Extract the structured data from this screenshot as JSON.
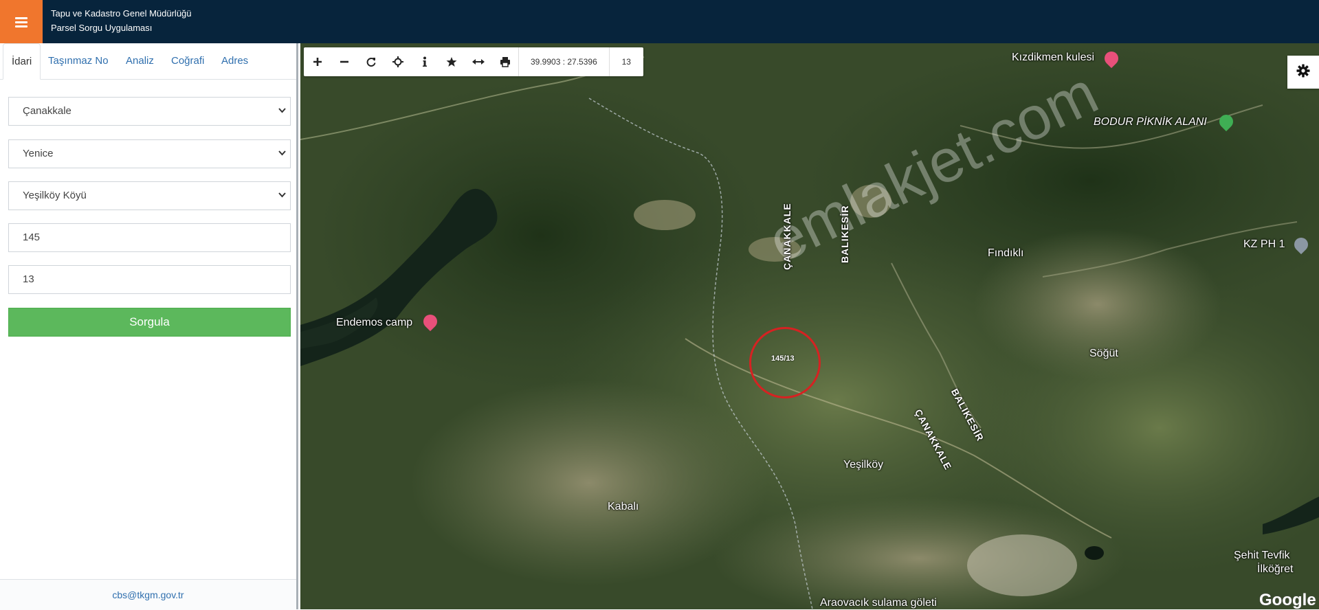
{
  "header": {
    "title_line1": "Tapu ve Kadastro Genel Müdürlüğü",
    "title_line2": "Parsel Sorgu Uygulaması",
    "menu_icon": "hamburger-icon",
    "colors": {
      "header_bg": "#07243c",
      "menu_bg": "#f0762d"
    }
  },
  "sidebar": {
    "tabs": [
      {
        "label": "İdari",
        "active": true
      },
      {
        "label": "Taşınmaz No",
        "active": false
      },
      {
        "label": "Analiz",
        "active": false
      },
      {
        "label": "Coğrafi",
        "active": false
      },
      {
        "label": "Adres",
        "active": false
      }
    ],
    "form": {
      "province": "Çanakkale",
      "district": "Yenice",
      "neighborhood": "Yeşilköy Köyü",
      "block": "145",
      "parcel": "13",
      "submit_label": "Sorgula"
    },
    "footer_email": "cbs@tkgm.gov.tr"
  },
  "map": {
    "toolbar": {
      "tools": [
        "zoom-in-icon",
        "zoom-out-icon",
        "refresh-icon",
        "locate-icon",
        "info-icon",
        "star-icon",
        "measure-icon",
        "print-icon"
      ],
      "coordinates": "39.9903 : 27.5396",
      "zoom": "13"
    },
    "settings_icon": "gear-icon",
    "labels": {
      "kizdikmen": "Kızdikmen kulesi",
      "bodur": "BODUR PİKNİK ALANI",
      "kzph": "KZ PH 1",
      "findikli": "Fındıklı",
      "endemos": "Endemos camp",
      "sogut": "Söğüt",
      "yesilkoy": "Yeşilköy",
      "kabali": "Kabalı",
      "aracvacik": "Araovacık sulama göleti",
      "sehit": "Şehit Tevfik",
      "ilkogret": "İlköğret",
      "canakkale_road1": "ÇANAKKALE",
      "balikesir_road1": "BALIKESİR",
      "canakkale_road2": "ÇANAKKALE",
      "balikesir_road2": "BALIKESİR"
    },
    "parcel_label": "145/13",
    "watermark": "emlakjet.com",
    "attribution": "Google",
    "colors": {
      "highlight_ring": "#d62222",
      "poi_pink": "#e8507a",
      "poi_green": "#3fae54",
      "poi_gray": "#8b97a3"
    }
  }
}
